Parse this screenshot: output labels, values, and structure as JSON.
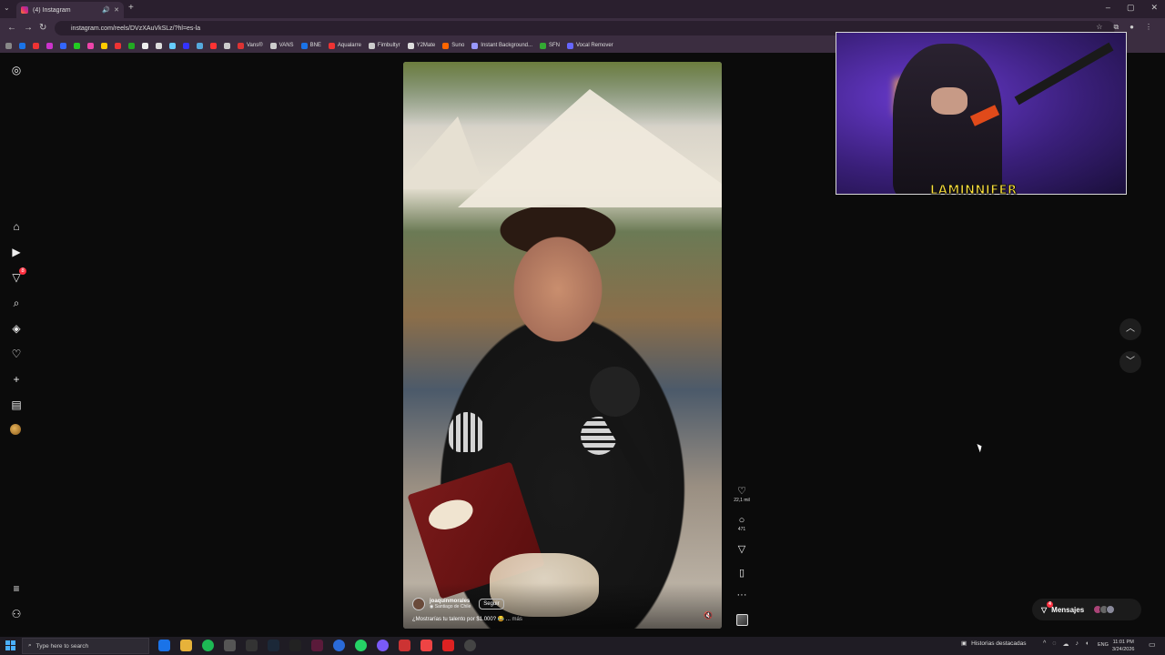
{
  "browser": {
    "tab_title": "(4) Instagram",
    "url": "instagram.com/reels/DVzXAuVkSLz/?hl=es-la",
    "bookmarks": [
      {
        "label": "Vans®",
        "color": "#d33"
      },
      {
        "label": "VANS",
        "color": "#ccc"
      },
      {
        "label": "BNE",
        "color": "#1a73e8"
      },
      {
        "label": "Aqualarre",
        "color": "#e33"
      },
      {
        "label": "Fimbultyr",
        "color": "#ccc"
      },
      {
        "label": "Y2Mate",
        "color": "#ddd"
      },
      {
        "label": "Suno",
        "color": "#f60"
      },
      {
        "label": "Instant Background...",
        "color": "#99f"
      },
      {
        "label": "SFN",
        "color": "#3a3"
      },
      {
        "label": "Vocal Remover",
        "color": "#66f"
      }
    ]
  },
  "instagram": {
    "sidebar_badge_count": "8",
    "reel": {
      "author": "joaquinmorales",
      "location": "Santiago de Chile",
      "follow_label": "Seguir",
      "caption": "¿Mostrarías tu talento por $1.000? 😂 ...",
      "more_label": "más",
      "likes": "22,1 mil",
      "comments": "471"
    },
    "messages": {
      "label": "Mensajes",
      "badge": "4"
    }
  },
  "stream_overlay": {
    "streamer_name": "LAMINNIFER"
  },
  "taskbar": {
    "search_placeholder": "Type here to search",
    "highlights_label": "Historias destacadas",
    "language": "ENG",
    "time": "11:01 PM",
    "date": "3/24/2026"
  },
  "colors": {
    "instagram_badge": "#ff3040",
    "overlay_name": "#ffe23a",
    "browser_chrome": "#3b2d40"
  }
}
